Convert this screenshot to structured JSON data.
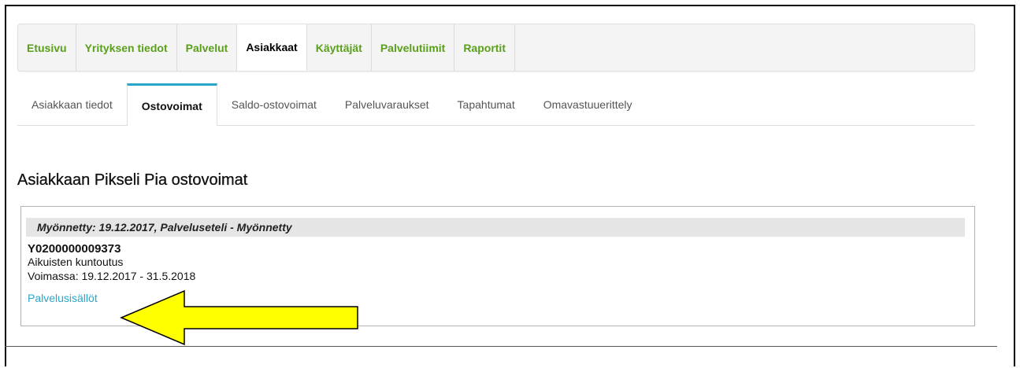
{
  "main_nav": {
    "items": [
      {
        "label": "Etusivu",
        "active": false
      },
      {
        "label": "Yrityksen tiedot",
        "active": false
      },
      {
        "label": "Palvelut",
        "active": false
      },
      {
        "label": "Asiakkaat",
        "active": true
      },
      {
        "label": "Käyttäjät",
        "active": false
      },
      {
        "label": "Palvelutiimit",
        "active": false
      },
      {
        "label": "Raportit",
        "active": false
      }
    ]
  },
  "sub_tabs": {
    "items": [
      {
        "label": "Asiakkaan tiedot",
        "active": false
      },
      {
        "label": "Ostovoimat",
        "active": true
      },
      {
        "label": "Saldo-ostovoimat",
        "active": false
      },
      {
        "label": "Palveluvaraukset",
        "active": false
      },
      {
        "label": "Tapahtumat",
        "active": false
      },
      {
        "label": "Omavastuuerittely",
        "active": false
      }
    ]
  },
  "page": {
    "title": "Asiakkaan Pikseli Pia ostovoimat"
  },
  "voucher": {
    "header": "Myönnetty:  19.12.2017, Palveluseteli - Myönnetty",
    "number": "Y0200000009373",
    "service": "Aikuisten kuntoutus",
    "validity": "Voimassa:  19.12.2017 - 31.5.2018",
    "link_label": "Palvelusisällöt"
  },
  "colors": {
    "nav_green": "#5a9f1a",
    "tab_accent": "#2aa6c8",
    "link": "#2aa6c8",
    "arrow_fill": "#ffff00"
  },
  "annotation": {
    "icon": "arrow-left-icon"
  }
}
